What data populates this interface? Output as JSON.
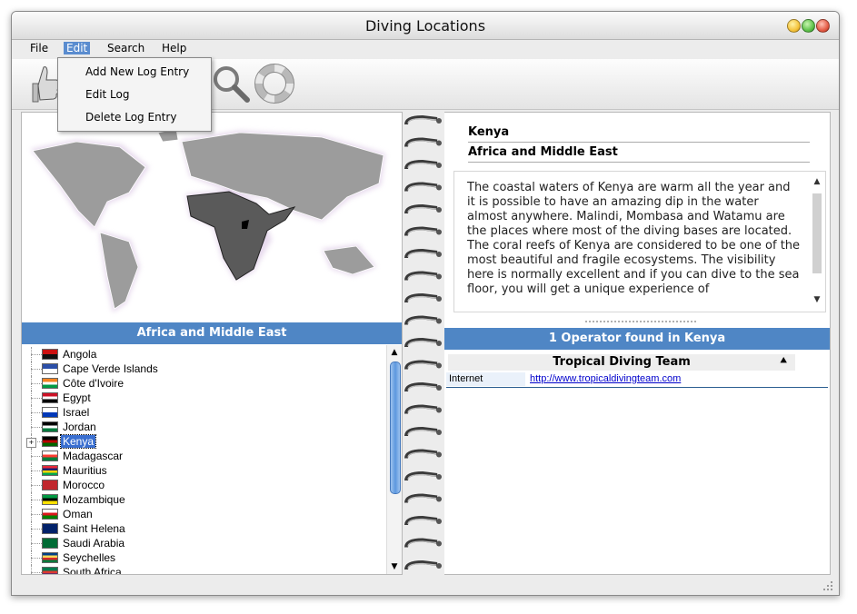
{
  "window": {
    "title": "Diving Locations",
    "buttons": [
      {
        "name": "minimize",
        "color": "#f5c33b"
      },
      {
        "name": "maximize",
        "color": "#5fc24b"
      },
      {
        "name": "close",
        "color": "#e45b45"
      }
    ]
  },
  "menu": {
    "items": [
      "File",
      "Edit",
      "Search",
      "Help"
    ],
    "active": "Edit"
  },
  "edit_menu": {
    "items": [
      "Add New Log Entry",
      "Edit Log",
      "Delete Log Entry"
    ]
  },
  "toolbar": {
    "tools": [
      "thumbs-up-icon",
      "magnifier-icon",
      "lifebuoy-icon"
    ]
  },
  "left": {
    "region": "Africa and Middle East",
    "countries": [
      {
        "name": "Angola",
        "colors": [
          "#cc1111",
          "#111111"
        ]
      },
      {
        "name": "Cape Verde Islands",
        "colors": [
          "#2b4fa8",
          "#ffffff"
        ]
      },
      {
        "name": "Côte d'Ivoire",
        "colors": [
          "#f58220",
          "#ffffff",
          "#009a44"
        ]
      },
      {
        "name": "Egypt",
        "colors": [
          "#ce1126",
          "#ffffff",
          "#000000"
        ]
      },
      {
        "name": "Israel",
        "colors": [
          "#ffffff",
          "#0038b8"
        ]
      },
      {
        "name": "Jordan",
        "colors": [
          "#000000",
          "#ffffff",
          "#007a3d"
        ]
      },
      {
        "name": "Kenya",
        "colors": [
          "#000000",
          "#bb0000",
          "#006600"
        ],
        "selected": true
      },
      {
        "name": "Madagascar",
        "colors": [
          "#ffffff",
          "#fc3d32",
          "#007e3a"
        ]
      },
      {
        "name": "Mauritius",
        "colors": [
          "#ea2839",
          "#1a206d",
          "#ffd500",
          "#00a551"
        ]
      },
      {
        "name": "Morocco",
        "colors": [
          "#c1272d",
          "#c1272d"
        ]
      },
      {
        "name": "Mozambique",
        "colors": [
          "#009a44",
          "#000000",
          "#fce100"
        ]
      },
      {
        "name": "Oman",
        "colors": [
          "#ffffff",
          "#db161b",
          "#008000"
        ]
      },
      {
        "name": "Saint Helena",
        "colors": [
          "#012169",
          "#012169"
        ]
      },
      {
        "name": "Saudi Arabia",
        "colors": [
          "#006c35",
          "#006c35"
        ]
      },
      {
        "name": "Seychelles",
        "colors": [
          "#003f87",
          "#fcd856",
          "#d62828",
          "#007a3d"
        ]
      },
      {
        "name": "South Africa",
        "colors": [
          "#007a4d",
          "#de3831",
          "#002395"
        ]
      }
    ]
  },
  "right": {
    "country": "Kenya",
    "region": "Africa and Middle East",
    "description": "The coastal waters of Kenya are warm all the year and it is possible to have an amazing dip in the water almost anywhere. Malindi, Mombasa and Watamu are the places where most of the diving bases are located. The coral reefs of Kenya are considered to be one of the most beautiful and fragile ecosystems. The visibility here is normally excellent and if you can dive to the sea floor, you will get a unique experience of",
    "operators_header": "1 Operator found in Kenya",
    "operator": {
      "name": "Tropical Diving Team",
      "field_label": "Internet",
      "url": "http://www.tropicaldivingteam.com"
    }
  },
  "colors": {
    "accent_bar": "#4f86c5",
    "selection": "#3a6fd0",
    "link": "#0000cc"
  }
}
